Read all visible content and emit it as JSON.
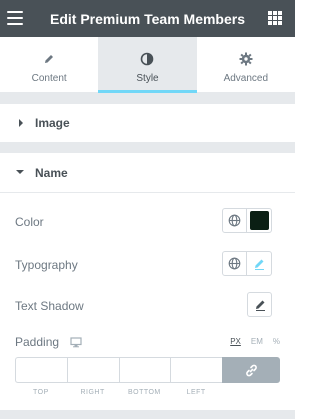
{
  "header": {
    "title": "Edit Premium Team Members"
  },
  "tabs": [
    {
      "label": "Content",
      "icon": "pencil-icon",
      "active": false
    },
    {
      "label": "Style",
      "icon": "contrast-icon",
      "active": true
    },
    {
      "label": "Advanced",
      "icon": "gear-icon",
      "active": false
    }
  ],
  "sections": {
    "image": {
      "title": "Image"
    },
    "name": {
      "title": "Name"
    }
  },
  "controls": {
    "color": {
      "label": "Color",
      "value": "#0b1f14"
    },
    "typography": {
      "label": "Typography"
    },
    "text_shadow": {
      "label": "Text Shadow"
    },
    "padding": {
      "label": "Padding",
      "units": [
        "PX",
        "EM",
        "%"
      ],
      "selected_unit": "PX",
      "sides": [
        "TOP",
        "RIGHT",
        "BOTTOM",
        "LEFT"
      ]
    }
  },
  "colors": {
    "header_bg": "#495157",
    "accent": "#71d7f7",
    "panel_bg": "#e6e9ec"
  }
}
